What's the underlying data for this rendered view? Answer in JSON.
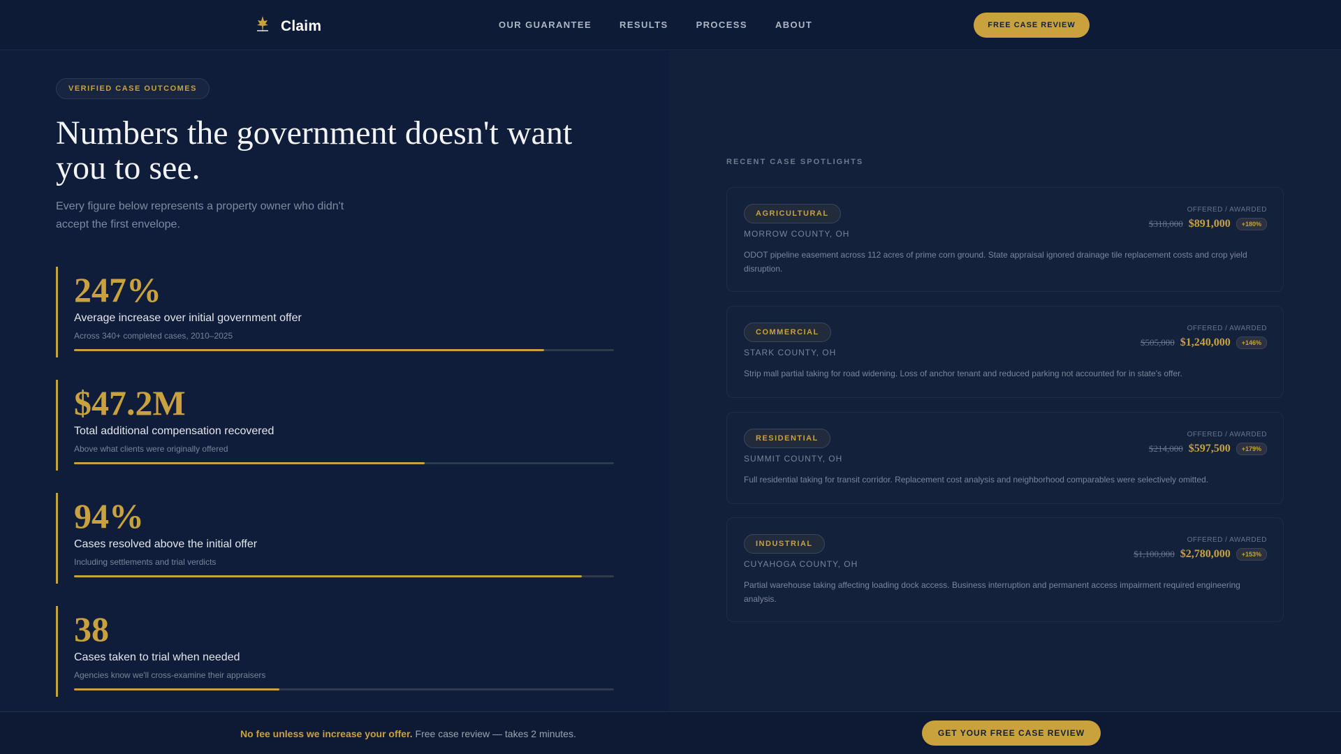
{
  "nav": {
    "brand": "Claim",
    "links": [
      "OUR GUARANTEE",
      "RESULTS",
      "PROCESS",
      "ABOUT"
    ],
    "cta": "FREE CASE REVIEW"
  },
  "hero": {
    "pill": "VERIFIED CASE OUTCOMES",
    "headline": "Numbers the government doesn't want you to see.",
    "subhead": "Every figure below represents a property owner who didn't accept the first envelope."
  },
  "stats": [
    {
      "value": "247%",
      "label": "Average increase over initial government offer",
      "note": "Across 340+ completed cases, 2010–2025",
      "progress": 0.87
    },
    {
      "value": "$47.2M",
      "label": "Total additional compensation recovered",
      "note": "Above what clients were originally offered",
      "progress": 0.65
    },
    {
      "value": "94%",
      "label": "Cases resolved above the initial offer",
      "note": "Including settlements and trial verdicts",
      "progress": 0.94
    },
    {
      "value": "38",
      "label": "Cases taken to trial when needed",
      "note": "Agencies know we'll cross-examine their appraisers",
      "progress": 0.38
    }
  ],
  "spotlights": {
    "section_label": "RECENT CASE SPOTLIGHTS",
    "offered_awarded_label": "OFFERED / AWARDED",
    "cases": [
      {
        "tag": "AGRICULTURAL",
        "county": "MORROW COUNTY, OH",
        "offered": "$318,000",
        "awarded": "$891,000",
        "pct": "+180%",
        "desc": "ODOT pipeline easement across 112 acres of prime corn ground. State appraisal ignored drainage tile replacement costs and crop yield disruption."
      },
      {
        "tag": "COMMERCIAL",
        "county": "STARK COUNTY, OH",
        "offered": "$505,000",
        "awarded": "$1,240,000",
        "pct": "+146%",
        "desc": "Strip mall partial taking for road widening. Loss of anchor tenant and reduced parking not accounted for in state's offer."
      },
      {
        "tag": "RESIDENTIAL",
        "county": "SUMMIT COUNTY, OH",
        "offered": "$214,000",
        "awarded": "$597,500",
        "pct": "+179%",
        "desc": "Full residential taking for transit corridor. Replacement cost analysis and neighborhood comparables were selectively omitted."
      },
      {
        "tag": "INDUSTRIAL",
        "county": "CUYAHOGA COUNTY, OH",
        "offered": "$1,100,000",
        "awarded": "$2,780,000",
        "pct": "+153%",
        "desc": "Partial warehouse taking affecting loading dock access. Business interruption and permanent access impairment required engineering analysis."
      }
    ]
  },
  "footer": {
    "strong": "No fee unless we increase your offer.",
    "text": " Free case review — takes 2 minutes.",
    "cta": "GET YOUR FREE CASE REVIEW"
  },
  "colors": {
    "accent": "#c9a23e",
    "background": "#0f1d3a",
    "panel": "#13203a"
  }
}
